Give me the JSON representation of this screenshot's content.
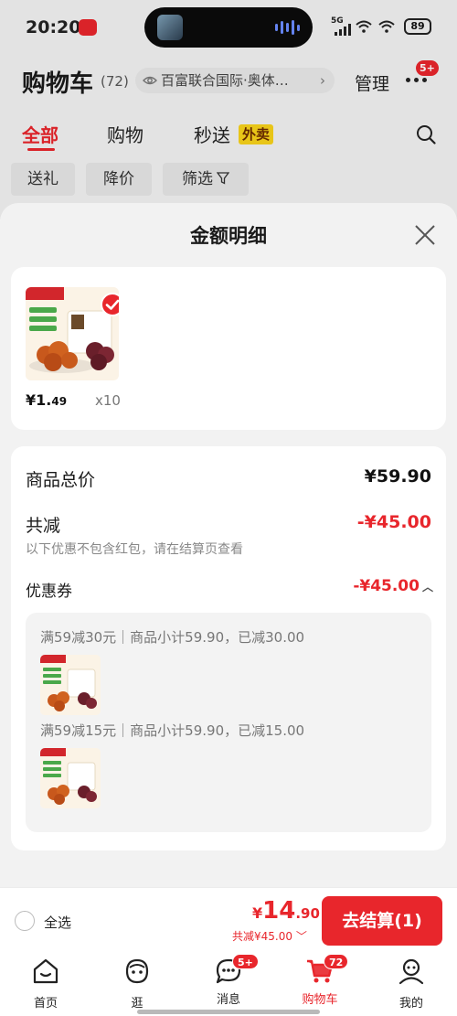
{
  "status_bar": {
    "time": "20:20",
    "network": "5G",
    "battery": "89"
  },
  "header": {
    "title": "购物车",
    "count": "(72)",
    "location": "百富联合国际·奥体…",
    "manage": "管理",
    "more_badge": "5+"
  },
  "tabs": [
    {
      "label": "全部",
      "active": true
    },
    {
      "label": "购物",
      "active": false
    },
    {
      "label": "秒送",
      "active": false,
      "tag": "外卖"
    }
  ],
  "filters": [
    "送礼",
    "降价",
    "筛选"
  ],
  "sheet": {
    "title": "金额明细",
    "product": {
      "price_main": "¥1.",
      "price_decimal": "49",
      "quantity": "x10"
    },
    "rows": {
      "total_label": "商品总价",
      "total_value": "¥59.90",
      "discount_label": "共减",
      "discount_value": "-¥45.00",
      "discount_note": "以下优惠不包含红包，请在结算页查看",
      "coupon_label": "优惠券",
      "coupon_value": "-¥45.00"
    },
    "coupons": [
      {
        "text": "满59减30元｜商品小计59.90，已减30.00"
      },
      {
        "text": "满59减15元｜商品小计59.90，已减15.00"
      }
    ]
  },
  "checkout": {
    "select_all": "全选",
    "total_currency": "¥",
    "total_integer": "14",
    "total_decimal": ".90",
    "total_discount": "共减¥45.00",
    "button": "去结算(1)"
  },
  "tabbar": [
    {
      "label": "首页",
      "icon": "home-icon",
      "badge": ""
    },
    {
      "label": "逛",
      "icon": "browse-face-icon",
      "badge": ""
    },
    {
      "label": "消息",
      "icon": "message-icon",
      "badge": "5+"
    },
    {
      "label": "购物车",
      "icon": "cart-icon",
      "badge": "72",
      "active": true
    },
    {
      "label": "我的",
      "icon": "profile-icon",
      "badge": ""
    }
  ],
  "colors": {
    "accent": "#e8262c",
    "tag_yellow": "#f7d21a"
  }
}
